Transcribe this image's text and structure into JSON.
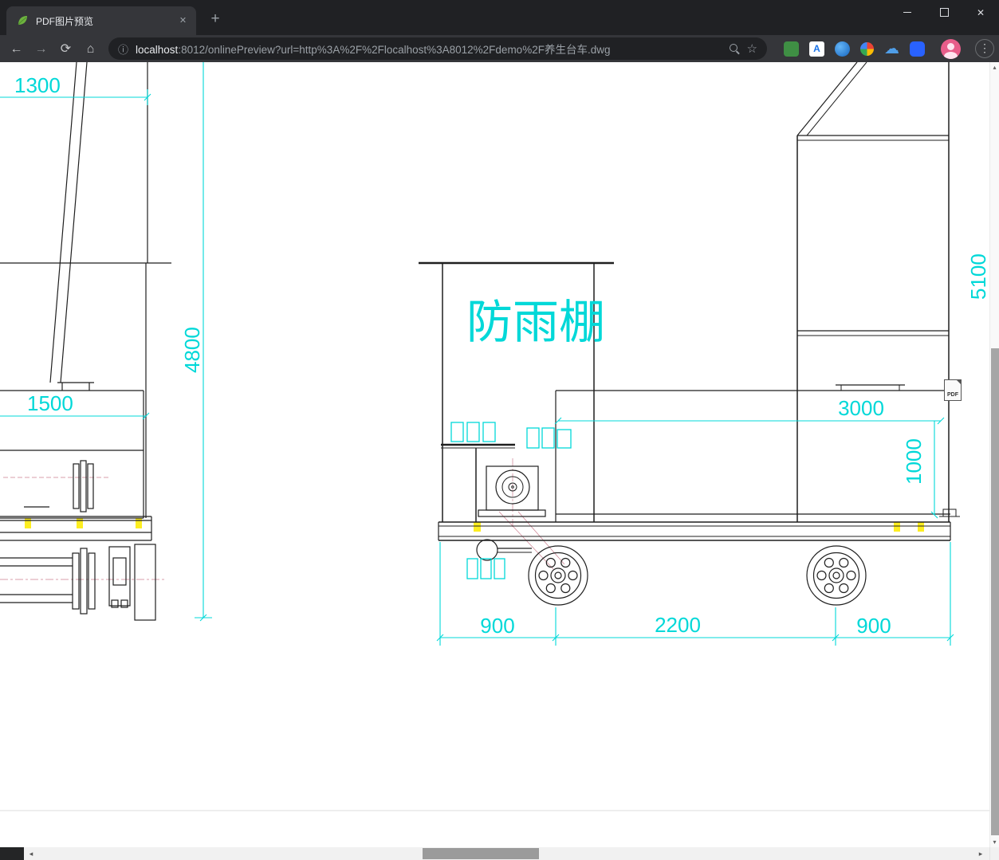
{
  "window": {
    "title": "PDF图片预览"
  },
  "toolbar": {
    "url_host": "localhost",
    "url_rest": ":8012/onlinePreview?url=http%3A%2F%2Flocalhost%3A8012%2Fdemo%2F养生台车.dwg"
  },
  "icons": {
    "close": "✕",
    "plus": "+",
    "back": "←",
    "forward": "→",
    "refresh": "⟳",
    "home": "⌂",
    "info": "ⓘ",
    "star": "☆",
    "menu": "⋮",
    "cloud": "☁",
    "translate_letter": "A",
    "scroll_up": "▴",
    "scroll_down": "▾",
    "scroll_left": "◂",
    "scroll_right": "▸"
  },
  "drawing": {
    "shelter_label": "防雨棚",
    "dims": {
      "top_width": "1300",
      "left_height": "4800",
      "platform_width": "1500",
      "bed_length": "3000",
      "bed_height": "1000",
      "right_height": "5100",
      "span_left": "900",
      "span_center": "2200",
      "span_right": "900"
    },
    "colors": {
      "dimension": "#00d8d8",
      "line": "#1f1f1f",
      "highlight": "#fdee21",
      "construction": "#cc8090"
    }
  },
  "pdf_badge": "PDF"
}
